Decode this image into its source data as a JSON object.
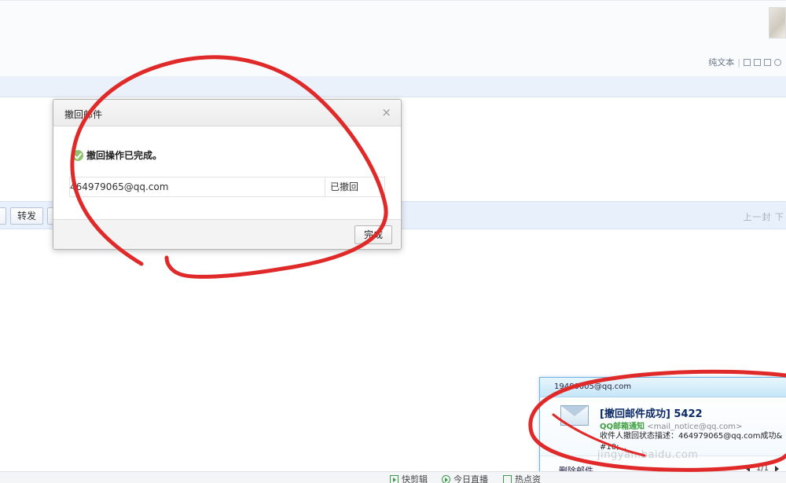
{
  "header": {
    "view_plain_text": "纯文本",
    "separator": "|"
  },
  "toolbar": {
    "forward_label": "转发",
    "pager_text": "上一封 下"
  },
  "dialog": {
    "title": "撤回邮件",
    "close_glyph": "×",
    "status_text": "撤回操作已完成。",
    "result": {
      "email": "464979065@qq.com",
      "state": "已撤回"
    },
    "done_label": "完成"
  },
  "notification": {
    "account": "19480005@qq.com",
    "subject": "[撤回邮件成功] 5422",
    "from_name": "QQ邮箱通知",
    "from_addr": "<mail_notice@qq.com>",
    "snippet": "收件人撤回状态描述：464979065@qq.com成功&#10;...",
    "delete_label": "删除邮件",
    "pager": "1/1"
  },
  "statusbar": {
    "items": [
      {
        "label": "快剪辑",
        "icon": "play-icon"
      },
      {
        "label": "今日直播",
        "icon": "live-icon"
      },
      {
        "label": "热点资",
        "icon": "news-icon"
      }
    ]
  },
  "watermark": "jingyan.baidu.com",
  "colors": {
    "annotation_red": "#e02a2a",
    "dialog_border": "#b3b3b3",
    "notification_border": "#6fb3e0",
    "success_green": "#8fc26d"
  }
}
